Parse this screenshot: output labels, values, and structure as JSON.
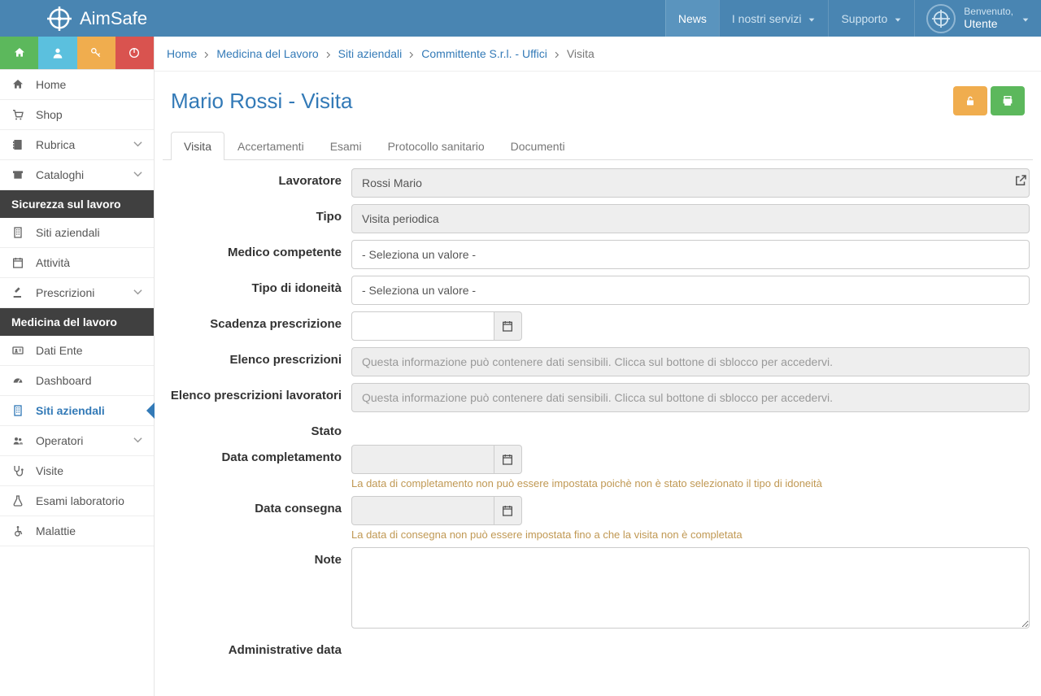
{
  "brand": "AimSafe",
  "topnav": {
    "news": "News",
    "servizi": "I nostri servizi",
    "supporto": "Supporto"
  },
  "user": {
    "welcome": "Benvenuto,",
    "name": "Utente"
  },
  "breadcrumb": {
    "home": "Home",
    "med": "Medicina del Lavoro",
    "siti": "Siti aziendali",
    "committente": "Committente S.r.l. - Uffici",
    "current": "Visita"
  },
  "page_title": "Mario Rossi - Visita",
  "tabs": {
    "visita": "Visita",
    "accertamenti": "Accertamenti",
    "esami": "Esami",
    "protocollo": "Protocollo sanitario",
    "documenti": "Documenti"
  },
  "sidebar": {
    "home": "Home",
    "shop": "Shop",
    "rubrica": "Rubrica",
    "cataloghi": "Cataloghi",
    "hdr_sicurezza": "Sicurezza sul lavoro",
    "siti_aziendali": "Siti aziendali",
    "attivita": "Attività",
    "prescrizioni": "Prescrizioni",
    "hdr_medicina": "Medicina del lavoro",
    "dati_ente": "Dati Ente",
    "dashboard": "Dashboard",
    "siti_aziendali2": "Siti aziendali",
    "operatori": "Operatori",
    "visite": "Visite",
    "esami_lab": "Esami laboratorio",
    "malattie": "Malattie"
  },
  "form": {
    "lavoratore_label": "Lavoratore",
    "lavoratore_value": "Rossi Mario",
    "tipo_label": "Tipo",
    "tipo_value": "Visita periodica",
    "medico_label": "Medico competente",
    "medico_placeholder": "- Seleziona un valore -",
    "idoneita_label": "Tipo di idoneità",
    "idoneita_placeholder": "- Seleziona un valore -",
    "scadenza_label": "Scadenza prescrizione",
    "elenco_presc_label": "Elenco prescrizioni",
    "elenco_presc_lav_label": "Elenco prescrizioni lavoratori",
    "locked_text": "Questa informazione può contenere dati sensibili. Clicca sul bottone di sblocco per accedervi.",
    "stato_label": "Stato",
    "data_compl_label": "Data completamento",
    "data_compl_help": "La data di completamento non può essere impostata poichè non è stato selezionato il tipo di idoneità",
    "data_consegna_label": "Data consegna",
    "data_consegna_help": "La data di consegna non può essere impostata fino a che la visita non è completata",
    "note_label": "Note",
    "admin_label": "Administrative data"
  }
}
